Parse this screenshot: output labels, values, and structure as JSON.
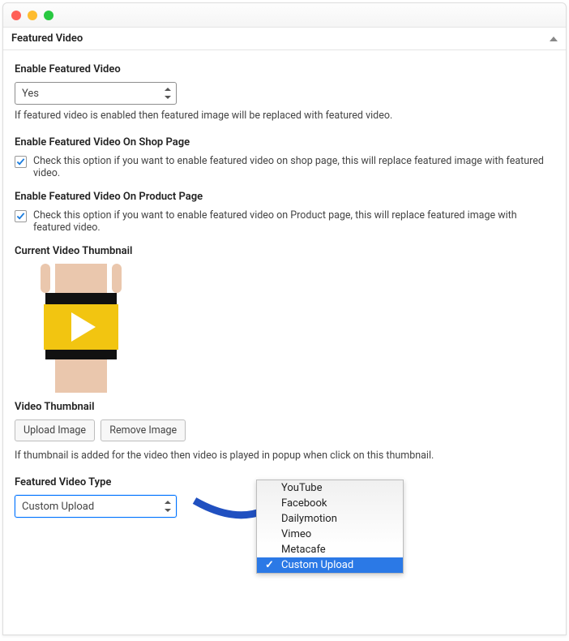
{
  "panel_title": "Featured Video",
  "enable_featured_video": {
    "label": "Enable Featured Video",
    "value": "Yes",
    "help": "If featured video is enabled then featured image will be replaced with featured video."
  },
  "shop_page": {
    "label": "Enable Featured Video On Shop Page",
    "checked": true,
    "text": "Check this option if you want to enable featured video on shop page, this will replace featured image with featured video."
  },
  "product_page": {
    "label": "Enable Featured Video On Product Page",
    "checked": true,
    "text": "Check this option if you want to enable featured video on Product page, this will replace featured image with featured video."
  },
  "thumb": {
    "label": "Current Video Thumbnail",
    "section_label": "Video Thumbnail",
    "upload_label": "Upload Image",
    "remove_label": "Remove Image",
    "help": "If thumbnail is added for the video then video is played in popup when click on this thumbnail."
  },
  "video_type": {
    "label": "Featured Video Type",
    "value": "Custom Upload",
    "options": [
      "YouTube",
      "Facebook",
      "Dailymotion",
      "Vimeo",
      "Metacafe",
      "Custom Upload"
    ],
    "selected": "Custom Upload"
  }
}
